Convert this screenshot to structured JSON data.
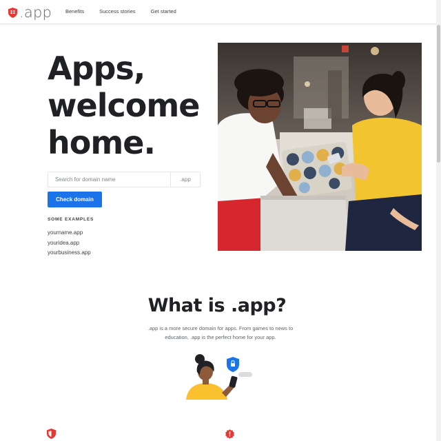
{
  "header": {
    "logo_text": ".app",
    "nav": [
      "Benefits",
      "Success stories",
      "Get started"
    ]
  },
  "hero": {
    "title_lines": [
      "Apps,",
      "welcome",
      "home."
    ],
    "search": {
      "placeholder": "Search for domain name",
      "suffix": ".app"
    },
    "button": "Check domain",
    "examples_heading": "SOME EXAMPLES",
    "examples": [
      "yourname.app",
      "youridea.app",
      "yourbusiness.app"
    ]
  },
  "about": {
    "title": "What is .app?",
    "description": ".app is a more secure domain for apps. From games to news to education, .app is the perfect home for your app."
  },
  "colors": {
    "brand_red": "#e53935",
    "accent_blue": "#1a73e8",
    "yellow": "#fbc02d"
  }
}
